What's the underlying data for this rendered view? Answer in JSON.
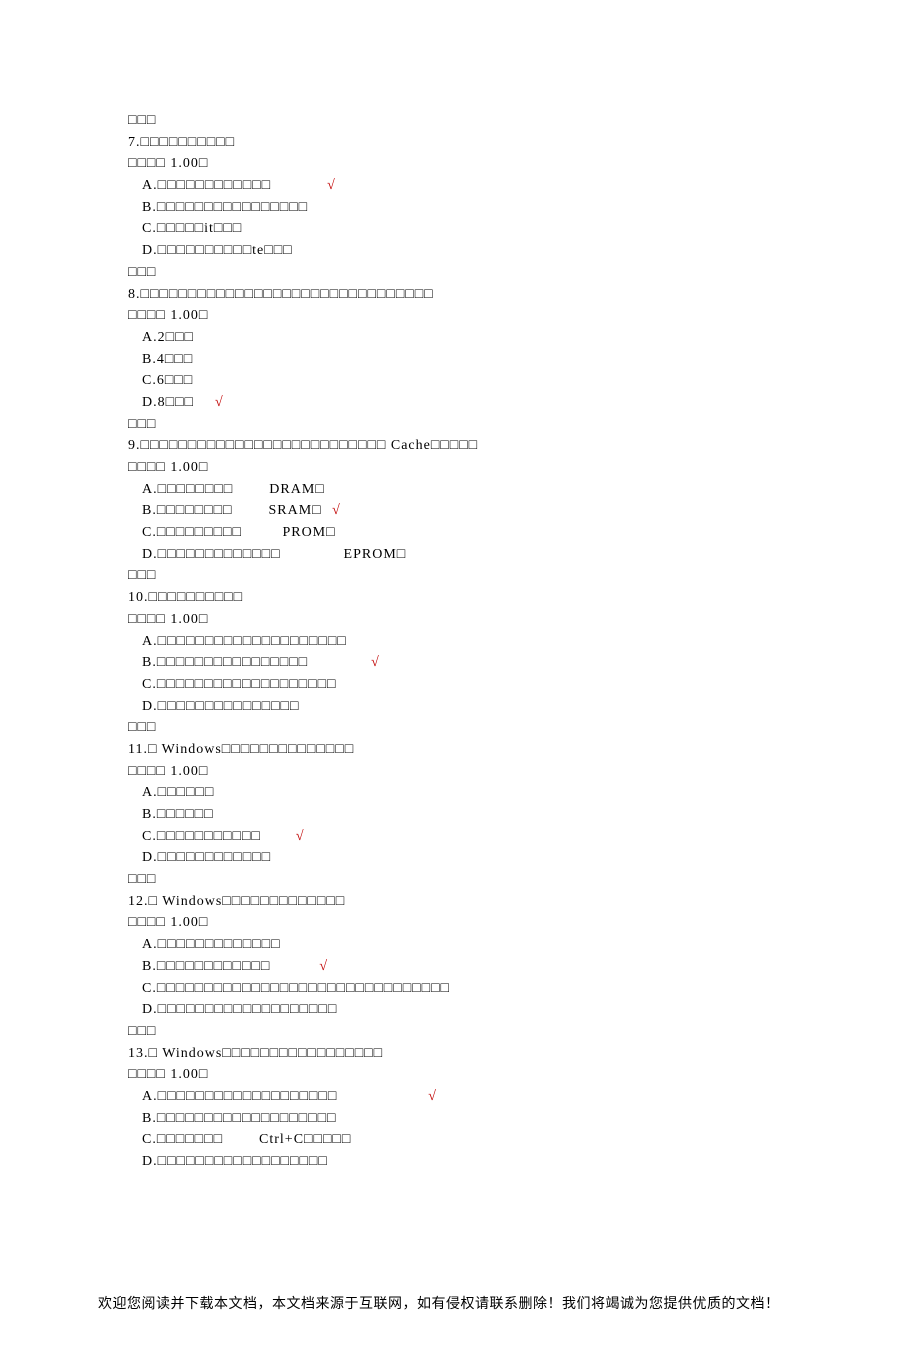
{
  "questions": [
    {
      "prelude": "□□□",
      "stem": "7.□□□□□□□□□□",
      "score": "□□□□    1.00□",
      "options": [
        {
          "text": "A.□□□□□□□□□□□□",
          "correct": true,
          "gap": "                "
        },
        {
          "text": "B.□□□□□□□□□□□□□□□□",
          "correct": false
        },
        {
          "text": "C.□□□□□it□□□",
          "correct": false
        },
        {
          "text": "D.□□□□□□□□□□te□□□",
          "correct": false
        }
      ]
    },
    {
      "prelude": "□□□",
      "stem": "8.□□□□□□□□□□□□□□□□□□□□□□□□□□□□□□□",
      "score": "□□□□    1.00□",
      "options": [
        {
          "text": "A.2□□□",
          "correct": false
        },
        {
          "text": "B.4□□□",
          "correct": false
        },
        {
          "text": "C.6□□□",
          "correct": false
        },
        {
          "text": "D.8□□□",
          "correct": true,
          "gap": "      "
        }
      ]
    },
    {
      "prelude": "□□□",
      "stem": "9.□□□□□□□□□□□□□□□□□□□□□□□□□□                              Cache□□□□□",
      "score": "□□□□    1.00□",
      "options": [
        {
          "text": "A.□□□□□□□□        DRAM□",
          "correct": false
        },
        {
          "text": "B.□□□□□□□□        SRAM□",
          "correct": true,
          "gap": "   "
        },
        {
          "text": "C.□□□□□□□□□         PROM□",
          "correct": false
        },
        {
          "text": "D.□□□□□□□□□□□□□              EPROM□",
          "correct": false
        }
      ]
    },
    {
      "prelude": "□□□",
      "stem": "10.□□□□□□□□□□",
      "score": "□□□□    1.00□",
      "options": [
        {
          "text": "A.□□□□□□□□□□□□□□□□□□□□",
          "correct": false
        },
        {
          "text": "B.□□□□□□□□□□□□□□□□",
          "correct": true,
          "gap": "                  "
        },
        {
          "text": "C.□□□□□□□□□□□□□□□□□□□",
          "correct": false
        },
        {
          "text": "D.□□□□□□□□□□□□□□□",
          "correct": false
        }
      ]
    },
    {
      "prelude": "□□□",
      "stem": "11.□  Windows□□□□□□□□□□□□□□",
      "score": "□□□□    1.00□",
      "options": [
        {
          "text": "A.□□□□□□",
          "correct": false
        },
        {
          "text": "B.□□□□□□",
          "correct": false
        },
        {
          "text": "C.□□□□□□□□□□□",
          "correct": true,
          "gap": "          "
        },
        {
          "text": "D.□□□□□□□□□□□□",
          "correct": false
        }
      ]
    },
    {
      "prelude": "□□□",
      "stem": "12.□  Windows□□□□□□□□□□□□□",
      "score": "□□□□    1.00□",
      "options": [
        {
          "text": "A.□□□□□□□□□□□□□",
          "correct": false
        },
        {
          "text": "B.□□□□□□□□□□□□",
          "correct": true,
          "gap": "              "
        },
        {
          "text": "C.□□□□□□□□□□□□□□□□□□□□□□□□□□□□□□□",
          "correct": false
        },
        {
          "text": "D.□□□□□□□□□□□□□□□□□□□",
          "correct": false
        }
      ]
    },
    {
      "prelude": "□□□",
      "stem": "13.□  Windows□□□□□□□□□□□□□□□□□",
      "score": "□□□□    1.00□",
      "options": [
        {
          "text": "A.□□□□□□□□□□□□□□□□□□□",
          "correct": true,
          "gap": "                          "
        },
        {
          "text": "B.□□□□□□□□□□□□□□□□□□□",
          "correct": false
        },
        {
          "text": "C.□□□□□□□        Ctrl+C□□□□□",
          "correct": false
        },
        {
          "text": "D.□□□□□□□□□□□□□□□□□□",
          "correct": false
        }
      ]
    }
  ],
  "checkMark": "√",
  "footer": "欢迎您阅读并下载本文档，本文档来源于互联网，如有侵权请联系删除！我们将竭诚为您提供优质的文档！"
}
